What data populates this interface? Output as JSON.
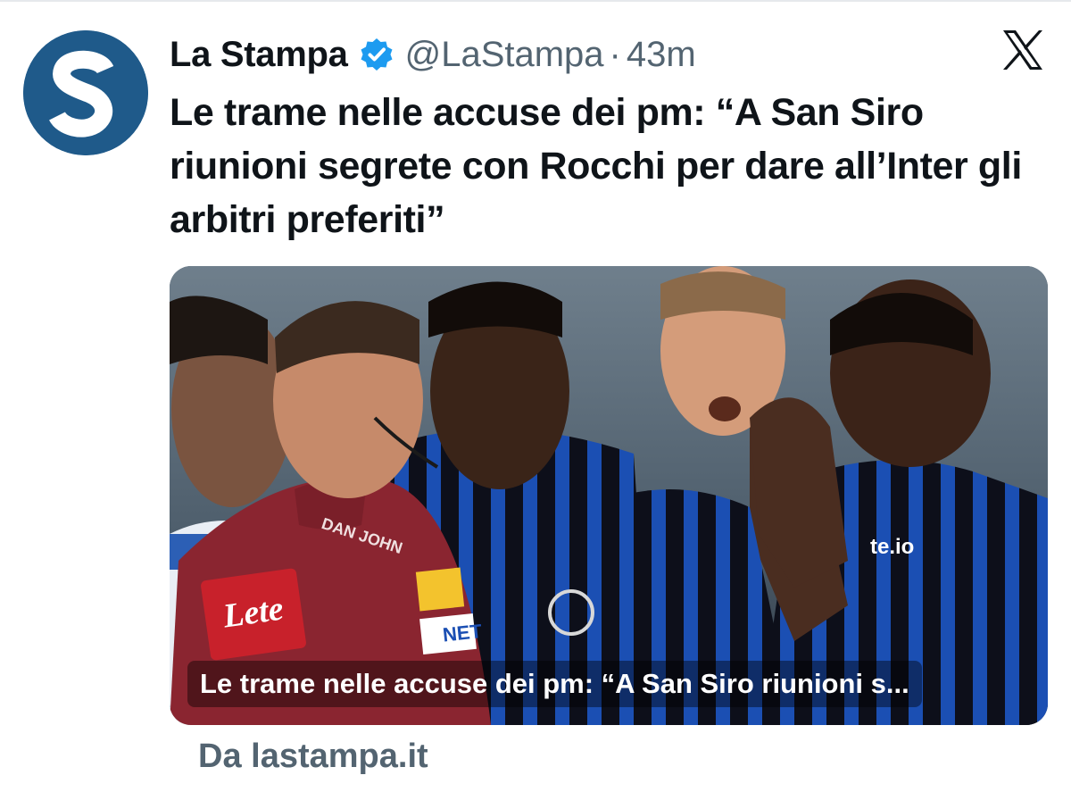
{
  "post": {
    "author_name": "La Stampa",
    "handle": "@LaStampa",
    "separator": "·",
    "time": "43m",
    "text": "Le trame nelle accuse dei pm: “A San Siro riunioni segrete con Rocchi per dare all’Inter gli arbitri preferiti”"
  },
  "card": {
    "caption": "Le trame nelle accuse dei pm: “A San Siro riunioni s...",
    "source": "Da lastampa.it",
    "image_text": {
      "sponsor_badge": "Lete",
      "shirt_brand": "DAN JOHN",
      "chest_logo": "NET",
      "sleeve_text": "te.io"
    }
  },
  "icons": {
    "avatar": "la-stampa-logo",
    "verified": "verified-badge-icon",
    "platform": "x-logo-icon"
  },
  "colors": {
    "verified": "#1d9bf0",
    "avatar_bg": "#1f5a8a",
    "meta_text": "#536471",
    "inter_stripe": "#1b4fb3"
  }
}
